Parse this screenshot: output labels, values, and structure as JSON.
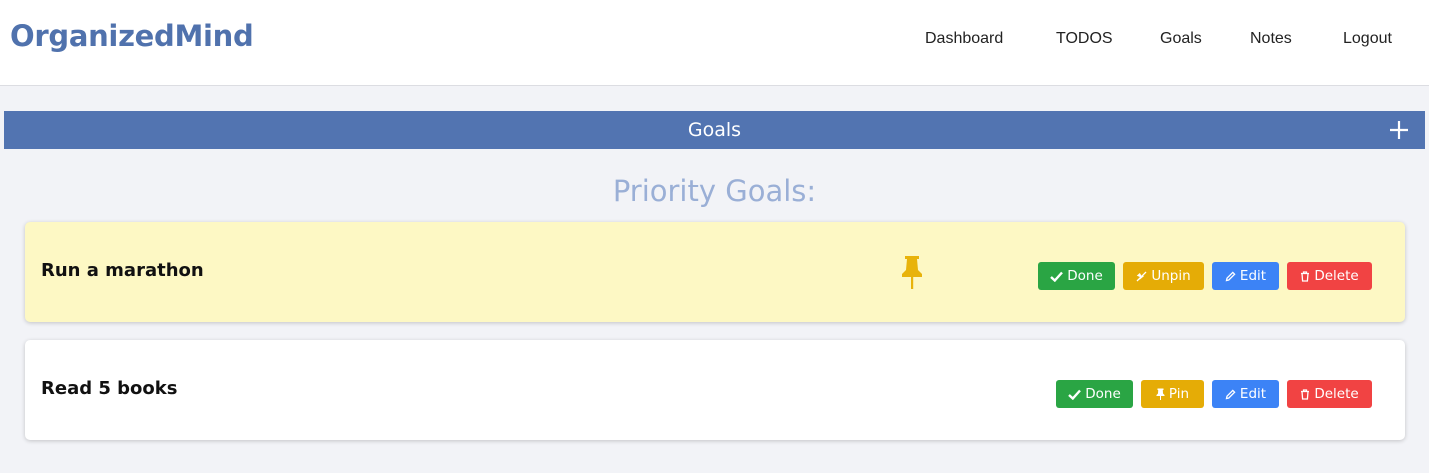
{
  "brand": "OrganizedMind",
  "nav": {
    "items": [
      {
        "label": "Dashboard"
      },
      {
        "label": "TODOS"
      },
      {
        "label": "Goals"
      },
      {
        "label": "Notes"
      },
      {
        "label": "Logout"
      }
    ]
  },
  "section": {
    "title": "Goals",
    "add_icon": "plus-icon"
  },
  "priority_heading": "Priority Goals:",
  "goals": [
    {
      "title": "Run a marathon",
      "pinned": true,
      "pin_indicator_icon": "pushpin-icon",
      "actions": {
        "done": "Done",
        "pin": "Unpin",
        "edit": "Edit",
        "delete": "Delete"
      }
    },
    {
      "title": "Read 5 books",
      "pinned": false,
      "actions": {
        "done": "Done",
        "pin": "Pin",
        "edit": "Edit",
        "delete": "Delete"
      }
    }
  ],
  "colors": {
    "brand": "#5072ad",
    "section_bar": "#5274b1",
    "pinned_card": "#fdf8c4",
    "done": "#2aa544",
    "pin": "#e5ac06",
    "edit": "#3c83f6",
    "delete": "#f14343"
  }
}
